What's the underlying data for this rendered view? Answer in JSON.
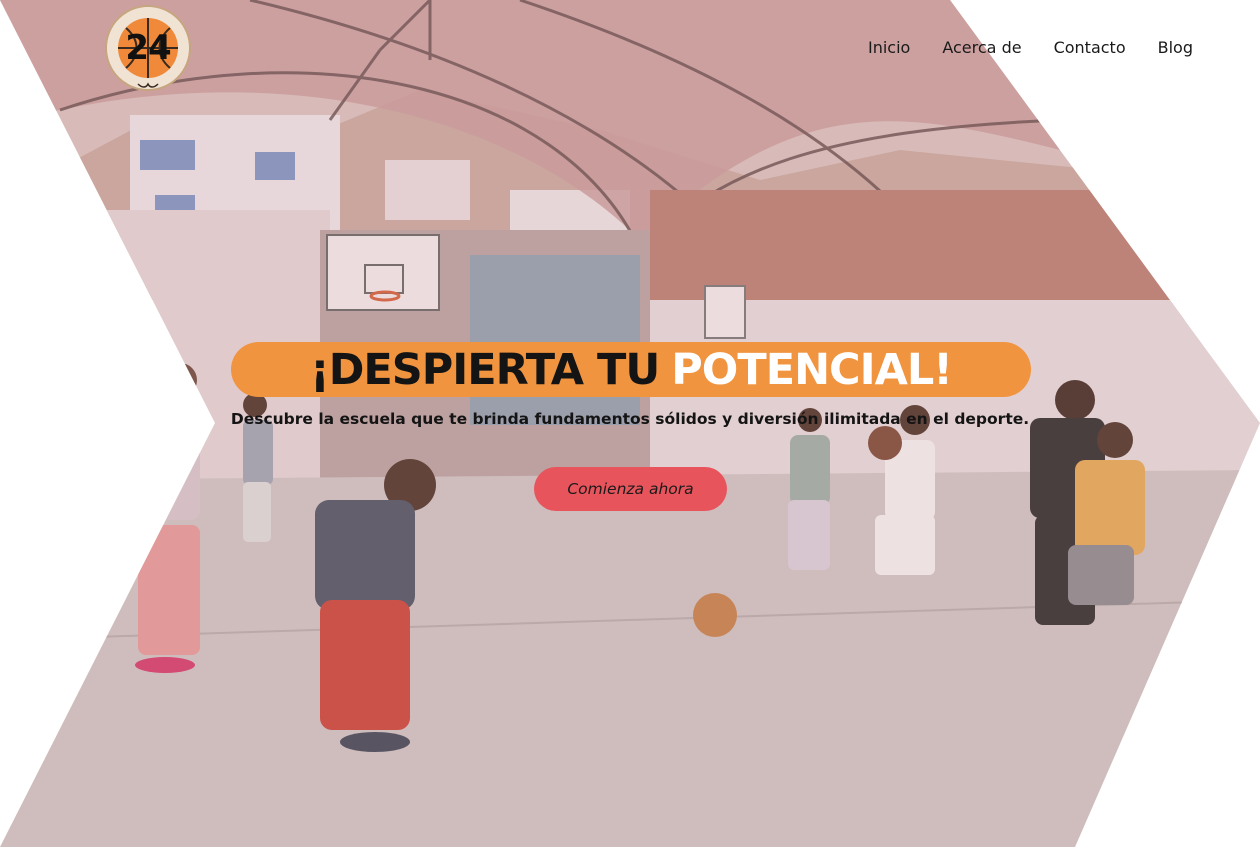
{
  "brand": {
    "logo_text": "24",
    "logo_ring_text": "VEINTICUATRO SEGUNDOS",
    "accent_color": "#f0943f"
  },
  "nav": {
    "items": [
      {
        "label": "Inicio"
      },
      {
        "label": "Acerca de"
      },
      {
        "label": "Contacto"
      },
      {
        "label": "Blog"
      }
    ]
  },
  "hero": {
    "headline_part1": "¡DESPIERTA TU",
    "headline_part2": "POTENCIAL!",
    "subtitle": "Descubre la escuela que te brinda fundamentos sólidos y diversión ilimitada en el deporte.",
    "cta_label": "Comienza ahora",
    "cta_color": "#e8545c",
    "image_subject": "children practicing basketball on a covered outdoor court"
  }
}
